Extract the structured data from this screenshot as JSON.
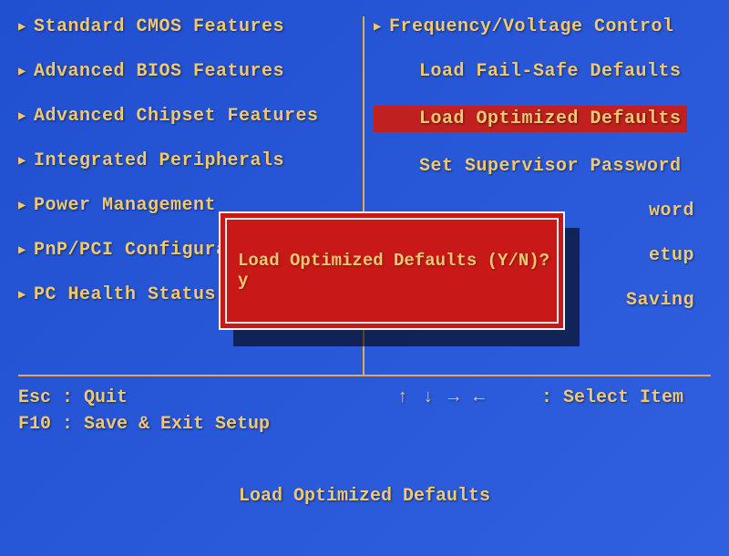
{
  "left_menu": [
    "Standard CMOS Features",
    "Advanced BIOS Features",
    "Advanced Chipset Features",
    "Integrated Peripherals",
    "Power Management",
    "PnP/PCI Configura",
    "PC Health Status"
  ],
  "right_menu_top": "Frequency/Voltage Control",
  "right_items": [
    "Load Fail-Safe Defaults",
    "Load Optimized Defaults",
    "Set Supervisor Password"
  ],
  "right_partial": [
    "word",
    "etup",
    "Saving"
  ],
  "help": {
    "esc": "Esc : Quit",
    "f10": "F10 : Save & Exit Setup",
    "arrows": "↑ ↓ → ←",
    "select": ": Select Item"
  },
  "footer": "Load Optimized Defaults",
  "dialog": {
    "message": "Load Optimized Defaults (Y/N)? y"
  }
}
